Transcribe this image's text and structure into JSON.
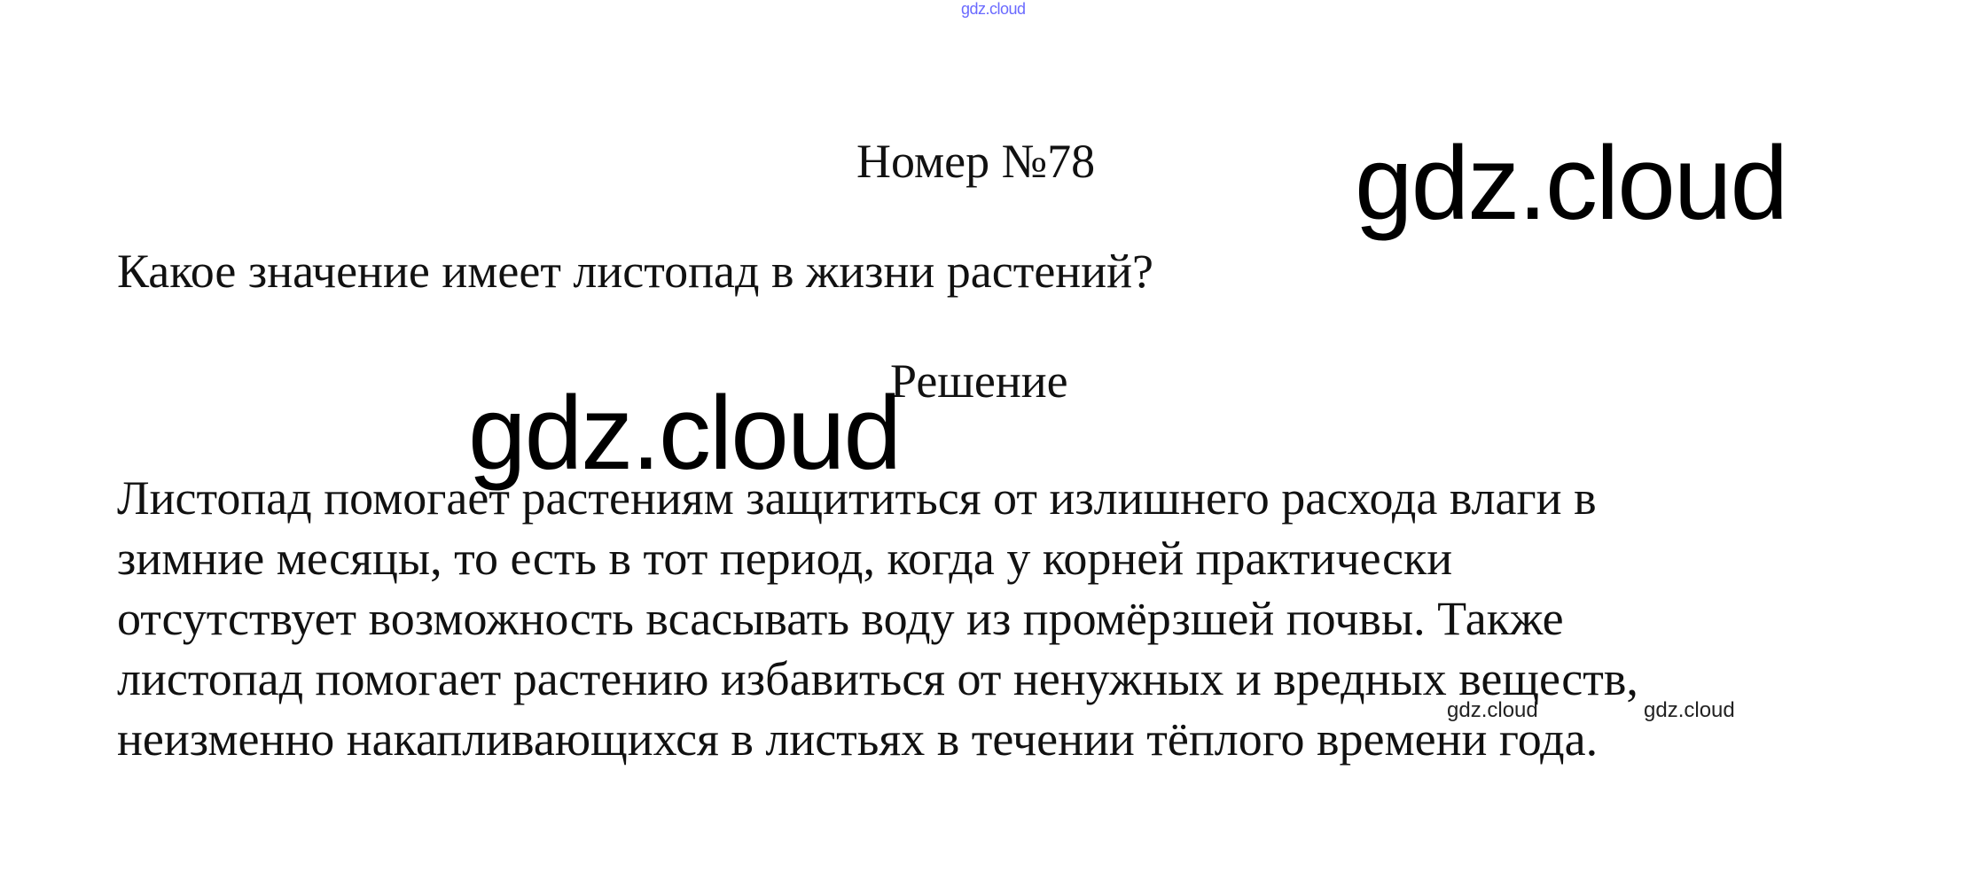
{
  "watermarks": {
    "top": "gdz.cloud",
    "large_right": "gdz.cloud",
    "large_center": "gdz.cloud",
    "small_1": "gdz.cloud",
    "small_2": "gdz.cloud"
  },
  "document": {
    "title": "Номер №78",
    "question": "Какое значение имеет листопад в жизни растений?",
    "solution_label": "Решение",
    "answer_lines": [
      "Листопад помогает растениям защититься от излишнего расхода влаги в",
      "зимние месяцы, то есть в тот период, когда у корней практически",
      "отсутствует возможность всасывать воду из промёрзшей почвы. Также",
      "листопад помогает растению избавиться от ненужных и вредных веществ,",
      "неизменно накапливающихся в листьях в течении тёплого времени года."
    ]
  }
}
